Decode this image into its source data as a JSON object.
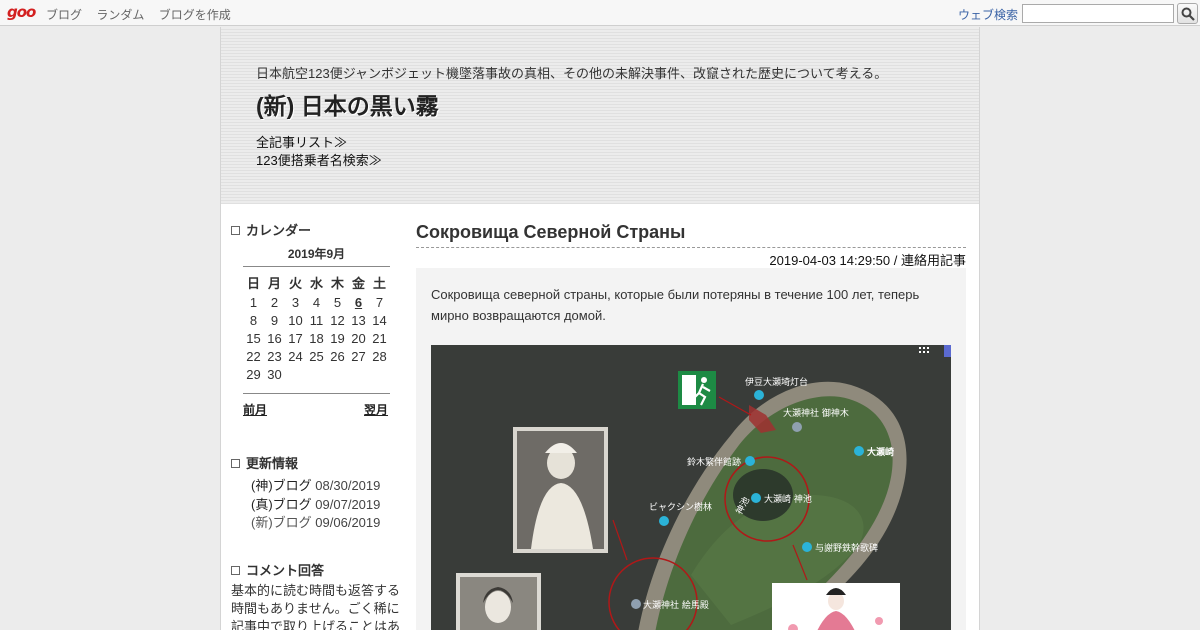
{
  "topbar": {
    "logo": "goo",
    "links": [
      "ブログ",
      "ランダム",
      "ブログを作成"
    ],
    "web_search_label": "ウェブ検索",
    "search_value": ""
  },
  "header": {
    "description": "日本航空123便ジャンボジェット機墜落事故の真相、その他の未解決事件、改竄された歴史について考える。",
    "title": "(新) 日本の黒い霧",
    "links": [
      "全記事リスト≫",
      "123便搭乗者名検索≫"
    ]
  },
  "calendar": {
    "heading": "カレンダー",
    "month": "2019年9月",
    "weekdays": [
      "日",
      "月",
      "火",
      "水",
      "木",
      "金",
      "土"
    ],
    "days": [
      "1",
      "2",
      "3",
      "4",
      "5",
      "6",
      "7",
      "8",
      "9",
      "10",
      "11",
      "12",
      "13",
      "14",
      "15",
      "16",
      "17",
      "18",
      "19",
      "20",
      "21",
      "22",
      "23",
      "24",
      "25",
      "26",
      "27",
      "28",
      "29",
      "30"
    ],
    "today": "6",
    "prev_label": "前月",
    "next_label": "翌月"
  },
  "updates": {
    "heading": "更新情報",
    "items": [
      {
        "name": "(神)ブログ",
        "date": "08/30/2019"
      },
      {
        "name": "(真)ブログ",
        "date": "09/07/2019"
      },
      {
        "name": "(新)ブログ",
        "date": "09/06/2019"
      }
    ]
  },
  "comments": {
    "heading": "コメント回答",
    "text": "基本的に読む時間も返答する時間もありません。ごく稀に記事中で取り上げることはあ"
  },
  "article": {
    "title": "Сокровища Северной Страны",
    "date": "2019-04-03 14:29:50",
    "separator": " / ",
    "category": "連絡用記事",
    "body": "Сокровища северной страны, которые были потеряны в течение 100 лет, теперь мирно возвращаются домой."
  },
  "map_labels": {
    "lighthouse": "伊豆大瀬埼灯台",
    "shrine_tree": "大瀬神社 御神木",
    "cape": "大瀬崎",
    "suzuki": "鈴木繁伴館跡",
    "pond": "大瀬崎 神池",
    "biyakushin": "ビャクシン樹林",
    "yosano": "与謝野鉄幹歌碑",
    "ema": "大瀬神社 絵馬殿",
    "shinchi_vertical": "神池"
  },
  "colors": {
    "accent_red": "#d32020",
    "link_blue": "#3a63a6",
    "exit_green": "#1d8a44"
  }
}
